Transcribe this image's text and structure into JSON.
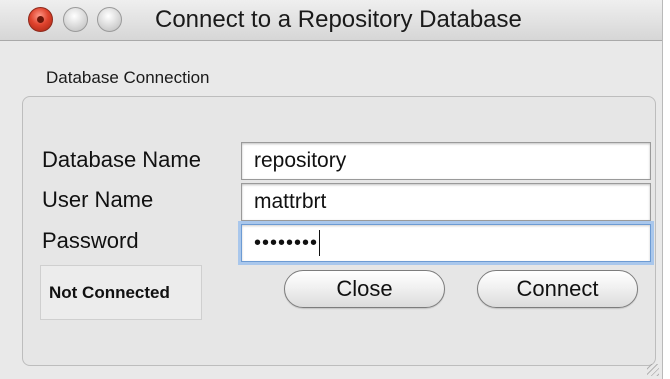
{
  "window": {
    "title": "Connect to a Repository Database"
  },
  "group": {
    "label": "Database Connection"
  },
  "fields": {
    "database_name": {
      "label": "Database Name",
      "value": "repository"
    },
    "user_name": {
      "label": "User Name",
      "value": "mattrbrt"
    },
    "password": {
      "label": "Password",
      "masked_value": "••••••••"
    }
  },
  "status": {
    "text": "Not Connected"
  },
  "buttons": {
    "close_label": "Close",
    "connect_label": "Connect"
  },
  "icons": {
    "close": "close-window-icon",
    "minimize": "minimize-window-icon",
    "zoom": "zoom-window-icon",
    "resize": "resize-grip-icon"
  }
}
